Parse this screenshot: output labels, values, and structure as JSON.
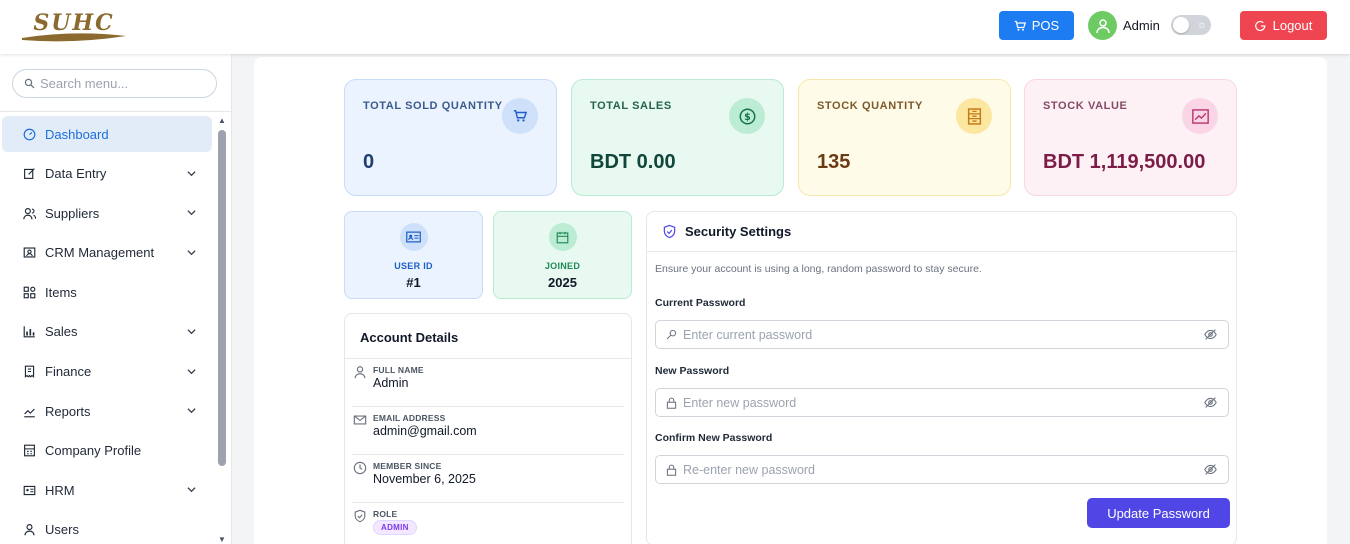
{
  "header": {
    "logo_alt": "SUHC",
    "pos_label": "POS",
    "user_name": "Admin",
    "theme_toggle_state": "off",
    "logout_label": "Logout"
  },
  "sidebar": {
    "search_placeholder": "Search menu...",
    "items": [
      {
        "label": "Dashboard",
        "icon": "gauge-icon",
        "active": true,
        "expandable": false
      },
      {
        "label": "Data Entry",
        "icon": "edit-icon",
        "expandable": true
      },
      {
        "label": "Suppliers",
        "icon": "users-icon",
        "expandable": true
      },
      {
        "label": "CRM Management",
        "icon": "crm-icon",
        "expandable": true
      },
      {
        "label": "Items",
        "icon": "grid-icon",
        "expandable": false
      },
      {
        "label": "Sales",
        "icon": "chart-bar-icon",
        "expandable": true
      },
      {
        "label": "Finance",
        "icon": "finance-icon",
        "expandable": true
      },
      {
        "label": "Reports",
        "icon": "line-chart-icon",
        "expandable": true
      },
      {
        "label": "Company Profile",
        "icon": "building-icon",
        "expandable": false
      },
      {
        "label": "HRM",
        "icon": "id-card-icon",
        "expandable": true
      },
      {
        "label": "Users",
        "icon": "user-icon",
        "expandable": false
      }
    ]
  },
  "stats": [
    {
      "label": "TOTAL SOLD QUANTITY",
      "value": "0",
      "icon": "cart-icon"
    },
    {
      "label": "TOTAL SALES",
      "value": "BDT 0.00",
      "icon": "dollar-icon"
    },
    {
      "label": "STOCK QUANTITY",
      "value": "135",
      "icon": "stock-icon"
    },
    {
      "label": "STOCK VALUE",
      "value": "BDT 1,119,500.00",
      "icon": "trend-icon"
    }
  ],
  "mini": {
    "user_id": {
      "label": "USER ID",
      "value": "#1"
    },
    "joined": {
      "label": "JOINED",
      "value": "2025"
    }
  },
  "account": {
    "title": "Account Details",
    "full_name": {
      "label": "FULL NAME",
      "value": "Admin"
    },
    "email": {
      "label": "EMAIL ADDRESS",
      "value": "admin@gmail.com"
    },
    "member_since": {
      "label": "MEMBER SINCE",
      "value": "November 6, 2025"
    },
    "role": {
      "label": "ROLE",
      "value": "ADMIN"
    }
  },
  "security": {
    "title": "Security Settings",
    "description": "Ensure your account is using a long, random password to stay secure.",
    "current": {
      "label": "Current Password",
      "placeholder": "Enter current password"
    },
    "new": {
      "label": "New Password",
      "placeholder": "Enter new password"
    },
    "confirm": {
      "label": "Confirm New Password",
      "placeholder": "Re-enter new password"
    },
    "button": "Update Password"
  },
  "colors": {
    "primary": "#1d7cf2",
    "danger": "#ef4550",
    "indigo": "#4f46e5"
  }
}
